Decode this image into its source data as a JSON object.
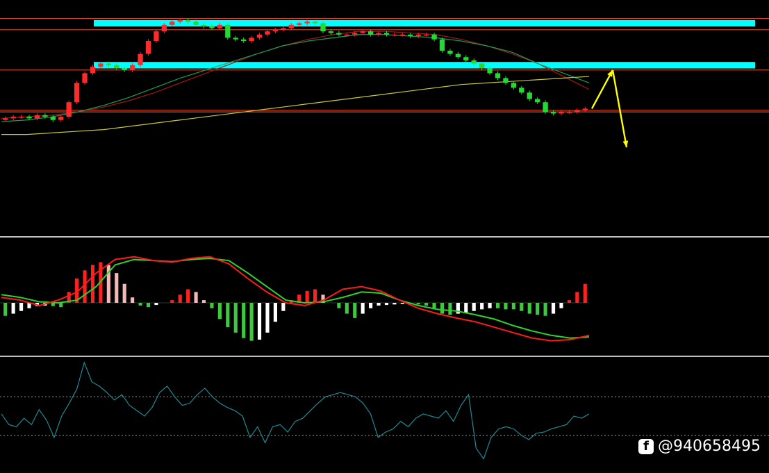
{
  "colors": {
    "background": "#000000",
    "candle_up": "#ff2a2a",
    "candle_down": "#25d934",
    "zone": "#00ffff",
    "level_line": "#e0462a",
    "ma_fast": "#a31515",
    "ma_mid": "#14a05a",
    "ma_slow": "#c8c832",
    "arrow": "#ffff00",
    "macd_fast": "#ff1a1a",
    "macd_slow": "#2cd42c",
    "hist_pos_strong": "#ff2020",
    "hist_pos_weak": "#f4b8b8",
    "hist_neg_strong": "#3fc83f",
    "hist_neg_weak": "#ffffff",
    "osc_line": "#1f8a95",
    "osc_ref": "#9a9a9a",
    "pane_separator": "#bfbfbf"
  },
  "watermark": {
    "icon": "facebook-icon",
    "text": "@940658495"
  },
  "chart_data": [
    {
      "type": "line",
      "pane": "price",
      "style": "candlestick",
      "ylim": [
        0,
        100
      ],
      "xlim": [
        0,
        80
      ],
      "close": [
        30,
        31,
        31,
        30,
        32,
        31,
        29,
        31,
        40,
        52,
        58,
        62,
        64,
        63,
        61,
        60,
        63,
        70,
        78,
        84,
        88,
        90,
        91,
        90,
        88,
        87,
        86,
        88,
        80,
        79,
        78,
        80,
        82,
        84,
        85,
        86,
        88,
        89,
        90,
        89,
        84,
        83,
        82,
        82,
        83,
        84,
        82,
        83,
        82,
        82,
        82,
        81,
        82,
        82,
        79,
        72,
        70,
        68,
        66,
        64,
        61,
        58,
        55,
        52,
        49,
        46,
        42,
        40,
        34,
        33,
        34,
        34,
        35,
        36
      ],
      "zones": [
        {
          "from": 87,
          "to": 91
        },
        {
          "from": 61,
          "to": 65
        }
      ],
      "levels": [
        92,
        85,
        60,
        35,
        34
      ],
      "moving_averages": [
        {
          "key": "ma_fast",
          "values": [
            30,
            31,
            32,
            34,
            37,
            41,
            46,
            52,
            58,
            64,
            70,
            75,
            79,
            82,
            84,
            84,
            83,
            82,
            79,
            75,
            70,
            64,
            56,
            48
          ]
        },
        {
          "key": "ma_mid",
          "values": [
            28,
            29,
            31,
            34,
            38,
            43,
            49,
            55,
            60,
            65,
            70,
            75,
            78,
            80,
            82,
            82,
            81,
            80,
            78,
            75,
            71,
            64,
            58,
            52
          ]
        },
        {
          "key": "ma_slow",
          "values": [
            20,
            20,
            21,
            22,
            23,
            25,
            27,
            29,
            31,
            33,
            35,
            37,
            39,
            41,
            43,
            45,
            47,
            49,
            51,
            52,
            53,
            54,
            55,
            56
          ]
        }
      ],
      "projection": [
        {
          "x": 73,
          "y": 36
        },
        {
          "x": 76,
          "y": 60
        },
        {
          "x": 78,
          "y": 12
        }
      ]
    },
    {
      "type": "bar",
      "pane": "macd",
      "ylim": [
        -1,
        1
      ],
      "histogram": [
        -0.24,
        -0.2,
        -0.15,
        -0.1,
        -0.06,
        -0.05,
        -0.06,
        -0.08,
        0.2,
        0.45,
        0.6,
        0.7,
        0.75,
        0.7,
        0.55,
        0.35,
        0.1,
        -0.05,
        -0.08,
        -0.04,
        0.0,
        0.05,
        0.15,
        0.25,
        0.2,
        0.05,
        -0.1,
        -0.3,
        -0.45,
        -0.55,
        -0.65,
        -0.7,
        -0.68,
        -0.55,
        -0.35,
        -0.15,
        0.05,
        0.15,
        0.22,
        0.25,
        0.15,
        0.0,
        -0.1,
        -0.2,
        -0.28,
        -0.2,
        -0.1,
        -0.05,
        -0.04,
        -0.03,
        -0.02,
        -0.02,
        -0.03,
        -0.05,
        -0.12,
        -0.2,
        -0.22,
        -0.2,
        -0.18,
        -0.15,
        -0.12,
        -0.1,
        -0.1,
        -0.12,
        -0.12,
        -0.15,
        -0.2,
        -0.22,
        -0.24,
        -0.2,
        -0.1,
        0.05,
        0.2,
        0.35
      ],
      "fast": [
        0.1,
        0.05,
        -0.05,
        0.05,
        0.2,
        0.55,
        0.8,
        0.85,
        0.78,
        0.75,
        0.82,
        0.85,
        0.72,
        0.45,
        0.2,
        0.0,
        -0.05,
        0.05,
        0.25,
        0.3,
        0.22,
        0.05,
        -0.1,
        -0.2,
        -0.28,
        -0.35,
        -0.45,
        -0.55,
        -0.65,
        -0.7,
        -0.68,
        -0.6
      ],
      "slow": [
        0.15,
        0.1,
        0.02,
        0.0,
        0.05,
        0.3,
        0.7,
        0.8,
        0.78,
        0.76,
        0.8,
        0.82,
        0.78,
        0.55,
        0.3,
        0.05,
        0.0,
        0.02,
        0.1,
        0.2,
        0.18,
        0.05,
        -0.05,
        -0.12,
        -0.15,
        -0.22,
        -0.3,
        -0.42,
        -0.52,
        -0.6,
        -0.65,
        -0.63
      ]
    },
    {
      "type": "line",
      "pane": "oscillator",
      "ylim": [
        0,
        100
      ],
      "reference_levels": [
        68,
        32
      ],
      "values": [
        52,
        42,
        40,
        48,
        42,
        56,
        46,
        30,
        50,
        62,
        75,
        100,
        82,
        78,
        72,
        65,
        70,
        60,
        55,
        50,
        58,
        72,
        78,
        68,
        60,
        62,
        70,
        76,
        68,
        62,
        58,
        55,
        50,
        30,
        40,
        25,
        40,
        42,
        35,
        45,
        48,
        55,
        62,
        68,
        70,
        72,
        70,
        68,
        62,
        52,
        30,
        35,
        38,
        45,
        40,
        48,
        52,
        50,
        48,
        55,
        45,
        60,
        70,
        20,
        10,
        30,
        38,
        40,
        38,
        32,
        28,
        34,
        35,
        38,
        40,
        42,
        50,
        48,
        52
      ]
    }
  ]
}
